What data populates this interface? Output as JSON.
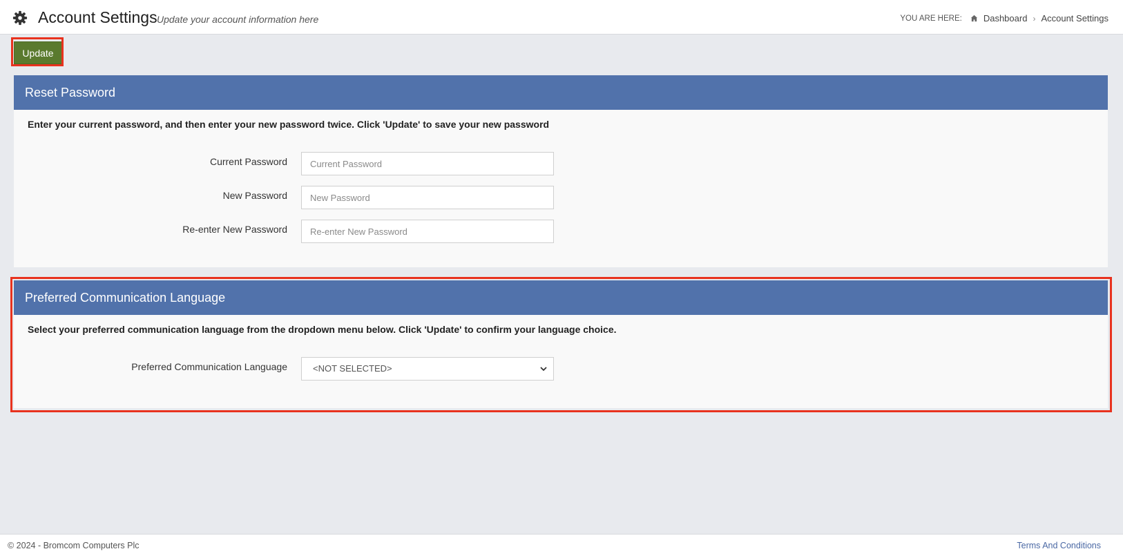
{
  "header": {
    "title": "Account Settings",
    "subtitle": "Update your account information here",
    "breadcrumb": {
      "label": "YOU ARE HERE:",
      "items": [
        "Dashboard",
        "Account Settings"
      ]
    }
  },
  "toolbar": {
    "update_label": "Update"
  },
  "reset_password": {
    "title": "Reset Password",
    "description": "Enter your current password, and then enter your new password twice. Click 'Update' to save your new password",
    "fields": [
      {
        "label": "Current Password",
        "placeholder": "Current Password",
        "value": ""
      },
      {
        "label": "New Password",
        "placeholder": "New Password",
        "value": ""
      },
      {
        "label": "Re-enter New Password",
        "placeholder": "Re-enter New Password",
        "value": ""
      }
    ]
  },
  "language": {
    "title": "Preferred Communication Language",
    "description": "Select your preferred communication language from the dropdown menu below. Click 'Update' to confirm your language choice.",
    "field_label": "Preferred Communication Language",
    "selected": "<NOT SELECTED>"
  },
  "footer": {
    "copyright": "© 2024 - Bromcom Computers Plc",
    "terms": "Terms And Conditions"
  },
  "colors": {
    "panel_header": "#5172ab",
    "update_button": "#5a7a2e",
    "highlight": "#e8321e",
    "background": "#e8eaee"
  },
  "icons": {
    "settings": "gear-icon",
    "home": "home-icon",
    "breadcrumb_separator": "chevron-right-icon",
    "select_arrow": "chevron-down-icon"
  }
}
